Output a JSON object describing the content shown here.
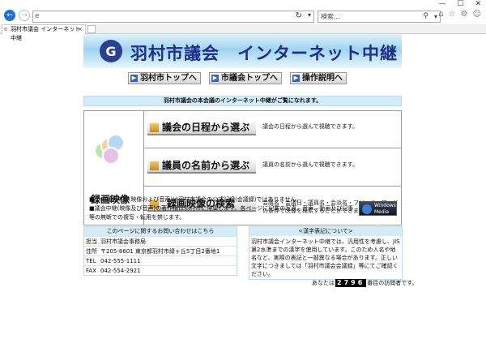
{
  "browser": {
    "window_controls": [
      "—",
      "☐",
      "✕"
    ],
    "search_placeholder": "検索...",
    "tab_title": "羽村市議会 インターネット中継",
    "address_value": ""
  },
  "page": {
    "banner_title": "羽村市議会　インターネット中継",
    "nav": [
      {
        "label": "羽村市トップへ"
      },
      {
        "label": "市議会トップへ"
      },
      {
        "label": "操作説明へ"
      }
    ],
    "intro": "羽村市議会の本会議のインターネット中継がご覧になれます。",
    "recording_label": "録画映像",
    "rows": [
      {
        "button": "議会の日程から選ぶ",
        "desc": "議会の日程から選んで視聴できます。"
      },
      {
        "button": "議員の名前から選ぶ",
        "desc": "議員の名前から選んで視聴できます。"
      },
      {
        "button": "録画映像の検索",
        "desc": "会議名・会議日・議員名・会派名・フリーキーワードの条件で映像を検索することができます。"
      }
    ],
    "notice_line1": "■この議会中継(映像および音声)は羽村市議会の公式記録(会議録)ではありません。",
    "notice_line2": "■議会中継(映像及び音声)の著作権は羽村市に帰属します。各ページに記載の写真、音声、動画及び記事等の無断での複写・転用を禁じます。",
    "wmp_label": "Windows Media Player 12",
    "contact": {
      "header": "このページに関するお問い合わせはこちら",
      "rows": [
        {
          "label": "担当",
          "value": "羽村市議会事務局"
        },
        {
          "label": "住所",
          "value": "〒205-8601 東京都羽村市緑ヶ丘5丁目2番地1"
        },
        {
          "label": "TEL",
          "value": "042-555-1111"
        },
        {
          "label": "FAX",
          "value": "042-554-2921"
        }
      ]
    },
    "kanji_notice": {
      "header": "<漢字表記について>",
      "body": "羽村市議会インターネット中継では、汎用性を考慮し、JIS第2水準までの漢字を使用しています。このため人名や地名など、実際の表記と一部異なる場合があります。正しい文字につきましては「羽村市議会会議録」等にてご確認ください。"
    },
    "counter": {
      "prefix": "あなたは",
      "value": "2796",
      "suffix": "番目の訪問者です。"
    }
  },
  "colors": {
    "accent_blue": "#1d2f86",
    "header_bg": "#d5ecf8"
  }
}
